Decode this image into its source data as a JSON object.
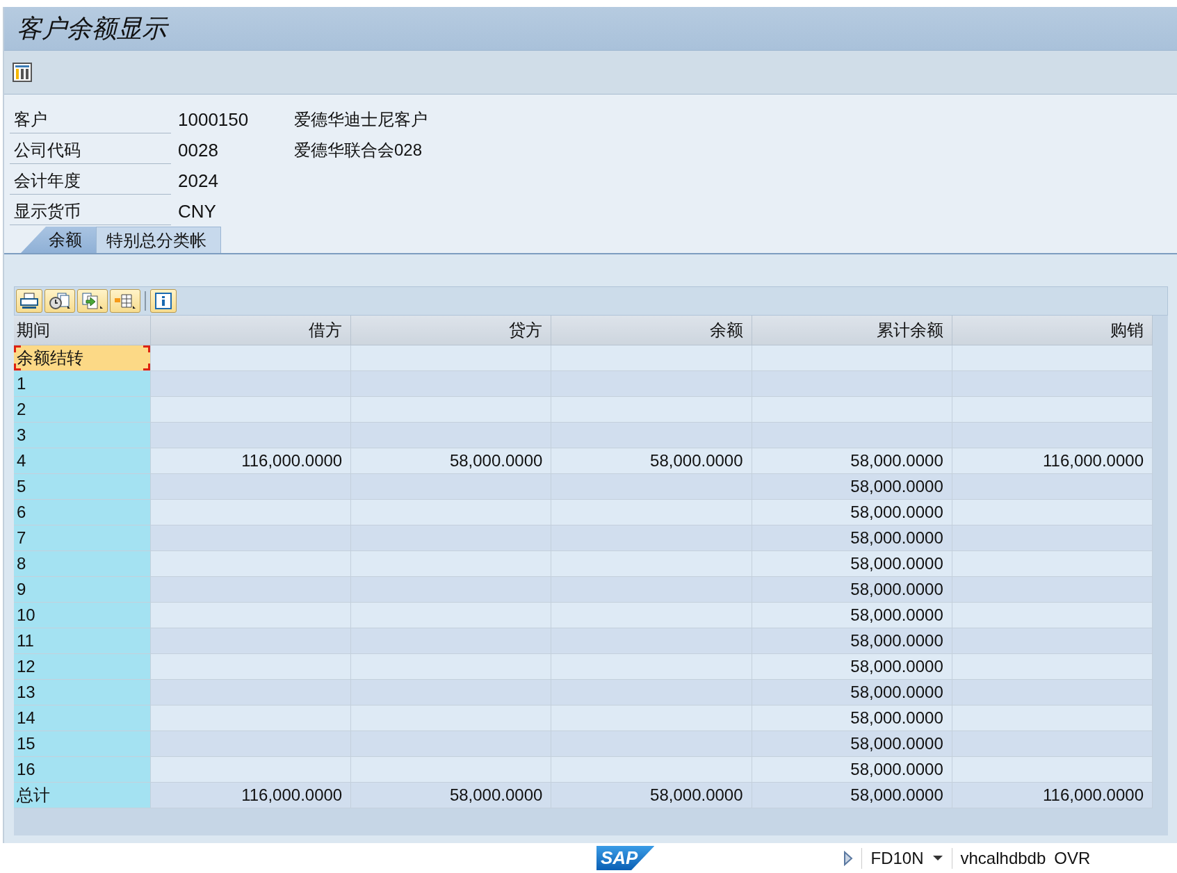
{
  "window": {
    "title": "客户余额显示"
  },
  "fields": [
    {
      "label": "客户",
      "value": "1000150",
      "description": "爱德华迪士尼客户"
    },
    {
      "label": "公司代码",
      "value": "0028",
      "description": "爱德华联合会028"
    },
    {
      "label": "会计年度",
      "value": "2024"
    },
    {
      "label": "显示货币",
      "value": "CNY"
    }
  ],
  "tabs": [
    {
      "label": "余额",
      "selected": true
    },
    {
      "label": "特别总分类帐",
      "selected": false
    }
  ],
  "table": {
    "columns": [
      "期间",
      "借方",
      "贷方",
      "余额",
      "累计余额",
      "购销"
    ],
    "rows": [
      {
        "cells": [
          "余额结转",
          "",
          "",
          "",
          "",
          ""
        ],
        "selected": true
      },
      {
        "cells": [
          "1",
          "",
          "",
          "",
          "",
          ""
        ],
        "selected": false
      },
      {
        "cells": [
          "2",
          "",
          "",
          "",
          "",
          ""
        ],
        "selected": false
      },
      {
        "cells": [
          "3",
          "",
          "",
          "",
          "",
          ""
        ],
        "selected": false
      },
      {
        "cells": [
          "4",
          "116,000.0000",
          "58,000.0000",
          "58,000.0000",
          "58,000.0000",
          "116,000.0000"
        ],
        "selected": false
      },
      {
        "cells": [
          "5",
          "",
          "",
          "",
          "58,000.0000",
          ""
        ],
        "selected": false
      },
      {
        "cells": [
          "6",
          "",
          "",
          "",
          "58,000.0000",
          ""
        ],
        "selected": false
      },
      {
        "cells": [
          "7",
          "",
          "",
          "",
          "58,000.0000",
          ""
        ],
        "selected": false
      },
      {
        "cells": [
          "8",
          "",
          "",
          "",
          "58,000.0000",
          ""
        ],
        "selected": false
      },
      {
        "cells": [
          "9",
          "",
          "",
          "",
          "58,000.0000",
          ""
        ],
        "selected": false
      },
      {
        "cells": [
          "10",
          "",
          "",
          "",
          "58,000.0000",
          ""
        ],
        "selected": false
      },
      {
        "cells": [
          "11",
          "",
          "",
          "",
          "58,000.0000",
          ""
        ],
        "selected": false
      },
      {
        "cells": [
          "12",
          "",
          "",
          "",
          "58,000.0000",
          ""
        ],
        "selected": false
      },
      {
        "cells": [
          "13",
          "",
          "",
          "",
          "58,000.0000",
          ""
        ],
        "selected": false
      },
      {
        "cells": [
          "14",
          "",
          "",
          "",
          "58,000.0000",
          ""
        ],
        "selected": false
      },
      {
        "cells": [
          "15",
          "",
          "",
          "",
          "58,000.0000",
          ""
        ],
        "selected": false
      },
      {
        "cells": [
          "16",
          "",
          "",
          "",
          "58,000.0000",
          ""
        ],
        "selected": false
      },
      {
        "cells": [
          "总计",
          "116,000.0000",
          "58,000.0000",
          "58,000.0000",
          "58,000.0000",
          "116,000.0000"
        ],
        "selected": false
      }
    ]
  },
  "status_bar": {
    "logo": "SAP",
    "transaction": "FD10N",
    "server": "vhcalhdbdb",
    "mode": "OVR"
  }
}
